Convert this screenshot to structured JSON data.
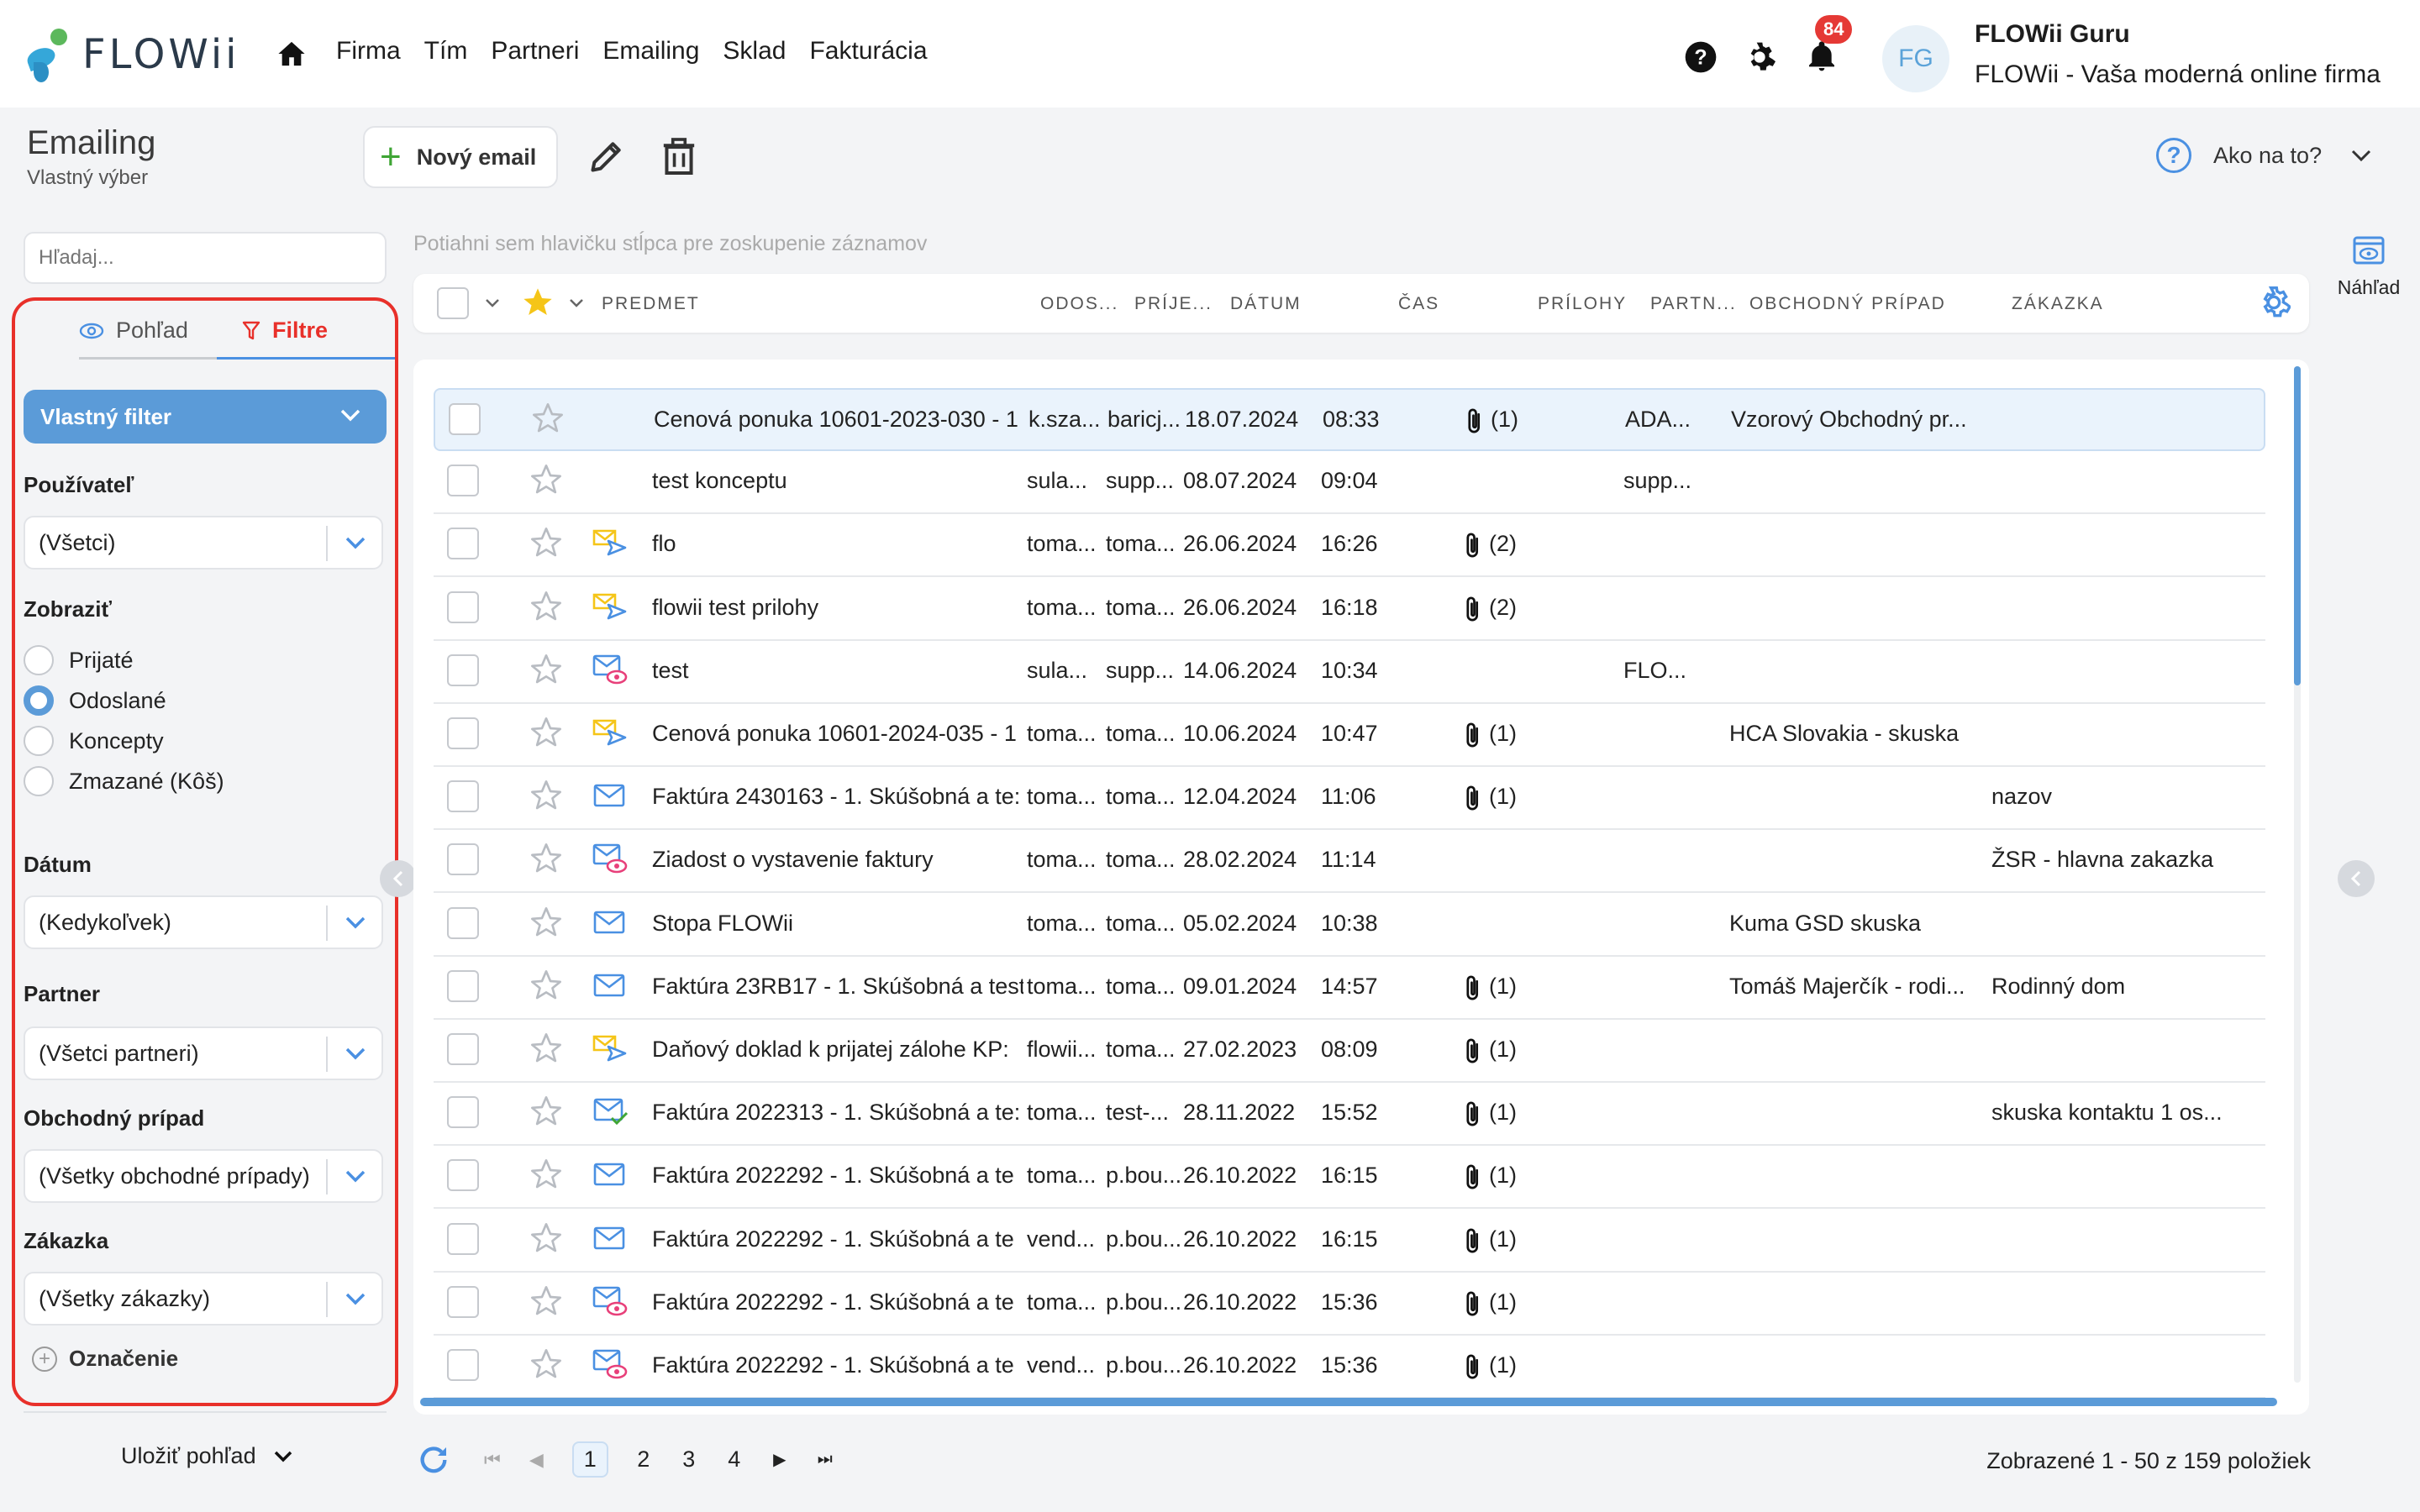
{
  "brand": {
    "name": "FLOWii"
  },
  "nav": {
    "items": [
      "Firma",
      "Tím",
      "Partneri",
      "Emailing",
      "Sklad",
      "Fakturácia"
    ]
  },
  "notifications": {
    "count": "84"
  },
  "user": {
    "initials": "FG",
    "name": "FLOWii Guru",
    "company": "FLOWii - Vaša moderná online firma"
  },
  "page": {
    "title": "Emailing",
    "subtitle": "Vlastný výber"
  },
  "toolbar": {
    "new_email": "Nový email"
  },
  "help": {
    "label": "Ako na to?"
  },
  "search": {
    "placeholder": "Hľadaj..."
  },
  "panel": {
    "tab_view": "Pohľad",
    "tab_filters": "Filtre",
    "custom_filter": "Vlastný filter",
    "user_label": "Používateľ",
    "user_value": "(Všetci)",
    "show_label": "Zobraziť",
    "show_options": [
      {
        "label": "Prijaté",
        "selected": false
      },
      {
        "label": "Odoslané",
        "selected": true
      },
      {
        "label": "Koncepty",
        "selected": false
      },
      {
        "label": "Zmazané (Kôš)",
        "selected": false
      }
    ],
    "date_label": "Dátum",
    "date_value": "(Kedykoľvek)",
    "partner_label": "Partner",
    "partner_value": "(Všetci partneri)",
    "case_label": "Obchodný prípad",
    "case_value": "(Všetky obchodné prípady)",
    "order_label": "Zákazka",
    "order_value": "(Všetky zákazky)",
    "marking": "Označenie",
    "save_view": "Uložiť pohľad"
  },
  "grid": {
    "group_hint": "Potiahni sem hlavičku stĺpca pre zoskupenie záznamov",
    "columns": [
      "PREDMET",
      "ODOS...",
      "PRÍJE...",
      "DÁTUM",
      "ČAS",
      "PRÍLOHY",
      "PARTN...",
      "OBCHODNÝ PRÍPAD",
      "ZÁKAZKA"
    ],
    "rows": [
      {
        "subject": "Cenová ponuka 10601-2023-030 - 1",
        "from": "k.sza...",
        "to": "baricj...",
        "date": "18.07.2024",
        "time": "08:33",
        "att": "(1)",
        "partner": "ADA...",
        "case": "Vzorový Obchodný pr...",
        "order": "",
        "icon": "none",
        "selected": true
      },
      {
        "subject": "test konceptu",
        "from": "sula...",
        "to": "supp...",
        "date": "08.07.2024",
        "time": "09:04",
        "att": "",
        "partner": "supp...",
        "case": "",
        "order": "",
        "icon": "none",
        "selected": false
      },
      {
        "subject": "flo",
        "from": "toma...",
        "to": "toma...",
        "date": "26.06.2024",
        "time": "16:26",
        "att": "(2)",
        "partner": "",
        "case": "",
        "order": "",
        "icon": "sent",
        "selected": false
      },
      {
        "subject": "flowii test prilohy",
        "from": "toma...",
        "to": "toma...",
        "date": "26.06.2024",
        "time": "16:18",
        "att": "(2)",
        "partner": "",
        "case": "",
        "order": "",
        "icon": "sent",
        "selected": false
      },
      {
        "subject": "test",
        "from": "sula...",
        "to": "supp...",
        "date": "14.06.2024",
        "time": "10:34",
        "att": "",
        "partner": "FLO...",
        "case": "",
        "order": "",
        "icon": "read",
        "selected": false
      },
      {
        "subject": "Cenová ponuka 10601-2024-035 - 1",
        "from": "toma...",
        "to": "toma...",
        "date": "10.06.2024",
        "time": "10:47",
        "att": "(1)",
        "partner": "",
        "case": "HCA Slovakia - skuska",
        "order": "",
        "icon": "sent",
        "selected": false
      },
      {
        "subject": "Faktúra 2430163 - 1. Skúšobná a te:",
        "from": "toma...",
        "to": "toma...",
        "date": "12.04.2024",
        "time": "11:06",
        "att": "(1)",
        "partner": "",
        "case": "",
        "order": "nazov",
        "icon": "mail",
        "selected": false
      },
      {
        "subject": "Ziadost o vystavenie faktury",
        "from": "toma...",
        "to": "toma...",
        "date": "28.02.2024",
        "time": "11:14",
        "att": "",
        "partner": "",
        "case": "",
        "order": "ŽSR - hlavna zakazka",
        "icon": "read",
        "selected": false
      },
      {
        "subject": "Stopa FLOWii",
        "from": "toma...",
        "to": "toma...",
        "date": "05.02.2024",
        "time": "10:38",
        "att": "",
        "partner": "",
        "case": "Kuma GSD skuska",
        "order": "",
        "icon": "mail",
        "selected": false
      },
      {
        "subject": "Faktúra 23RB17 - 1. Skúšobná a test",
        "from": "toma...",
        "to": "toma...",
        "date": "09.01.2024",
        "time": "14:57",
        "att": "(1)",
        "partner": "",
        "case": "Tomáš Majerčík - rodi...",
        "order": "Rodinný dom",
        "icon": "mail",
        "selected": false
      },
      {
        "subject": "Daňový doklad k prijatej zálohe KP:",
        "from": "flowii...",
        "to": "toma...",
        "date": "27.02.2023",
        "time": "08:09",
        "att": "(1)",
        "partner": "",
        "case": "",
        "order": "",
        "icon": "sent",
        "selected": false
      },
      {
        "subject": "Faktúra 2022313 - 1. Skúšobná a te:",
        "from": "toma...",
        "to": "test-...",
        "date": "28.11.2022",
        "time": "15:52",
        "att": "(1)",
        "partner": "",
        "case": "",
        "order": "skuska kontaktu 1 os...",
        "icon": "check",
        "selected": false
      },
      {
        "subject": "Faktúra 2022292 - 1. Skúšobná a te",
        "from": "toma...",
        "to": "p.bou...",
        "date": "26.10.2022",
        "time": "16:15",
        "att": "(1)",
        "partner": "",
        "case": "",
        "order": "",
        "icon": "mail",
        "selected": false
      },
      {
        "subject": "Faktúra 2022292 - 1. Skúšobná a te",
        "from": "vend...",
        "to": "p.bou...",
        "date": "26.10.2022",
        "time": "16:15",
        "att": "(1)",
        "partner": "",
        "case": "",
        "order": "",
        "icon": "mail",
        "selected": false
      },
      {
        "subject": "Faktúra 2022292 - 1. Skúšobná a te",
        "from": "toma...",
        "to": "p.bou...",
        "date": "26.10.2022",
        "time": "15:36",
        "att": "(1)",
        "partner": "",
        "case": "",
        "order": "",
        "icon": "read",
        "selected": false
      },
      {
        "subject": "Faktúra 2022292 - 1. Skúšobná a te",
        "from": "vend...",
        "to": "p.bou...",
        "date": "26.10.2022",
        "time": "15:36",
        "att": "(1)",
        "partner": "",
        "case": "",
        "order": "",
        "icon": "read",
        "selected": false
      }
    ]
  },
  "preview": {
    "label": "Náhľad"
  },
  "pager": {
    "pages": [
      "1",
      "2",
      "3",
      "4"
    ],
    "current": "1",
    "info": "Zobrazené 1 - 50 z 159 položiek"
  },
  "colors": {
    "accent": "#5b9bd8",
    "danger": "#e8302a",
    "green": "#3fa535",
    "star": "#f5c518"
  }
}
